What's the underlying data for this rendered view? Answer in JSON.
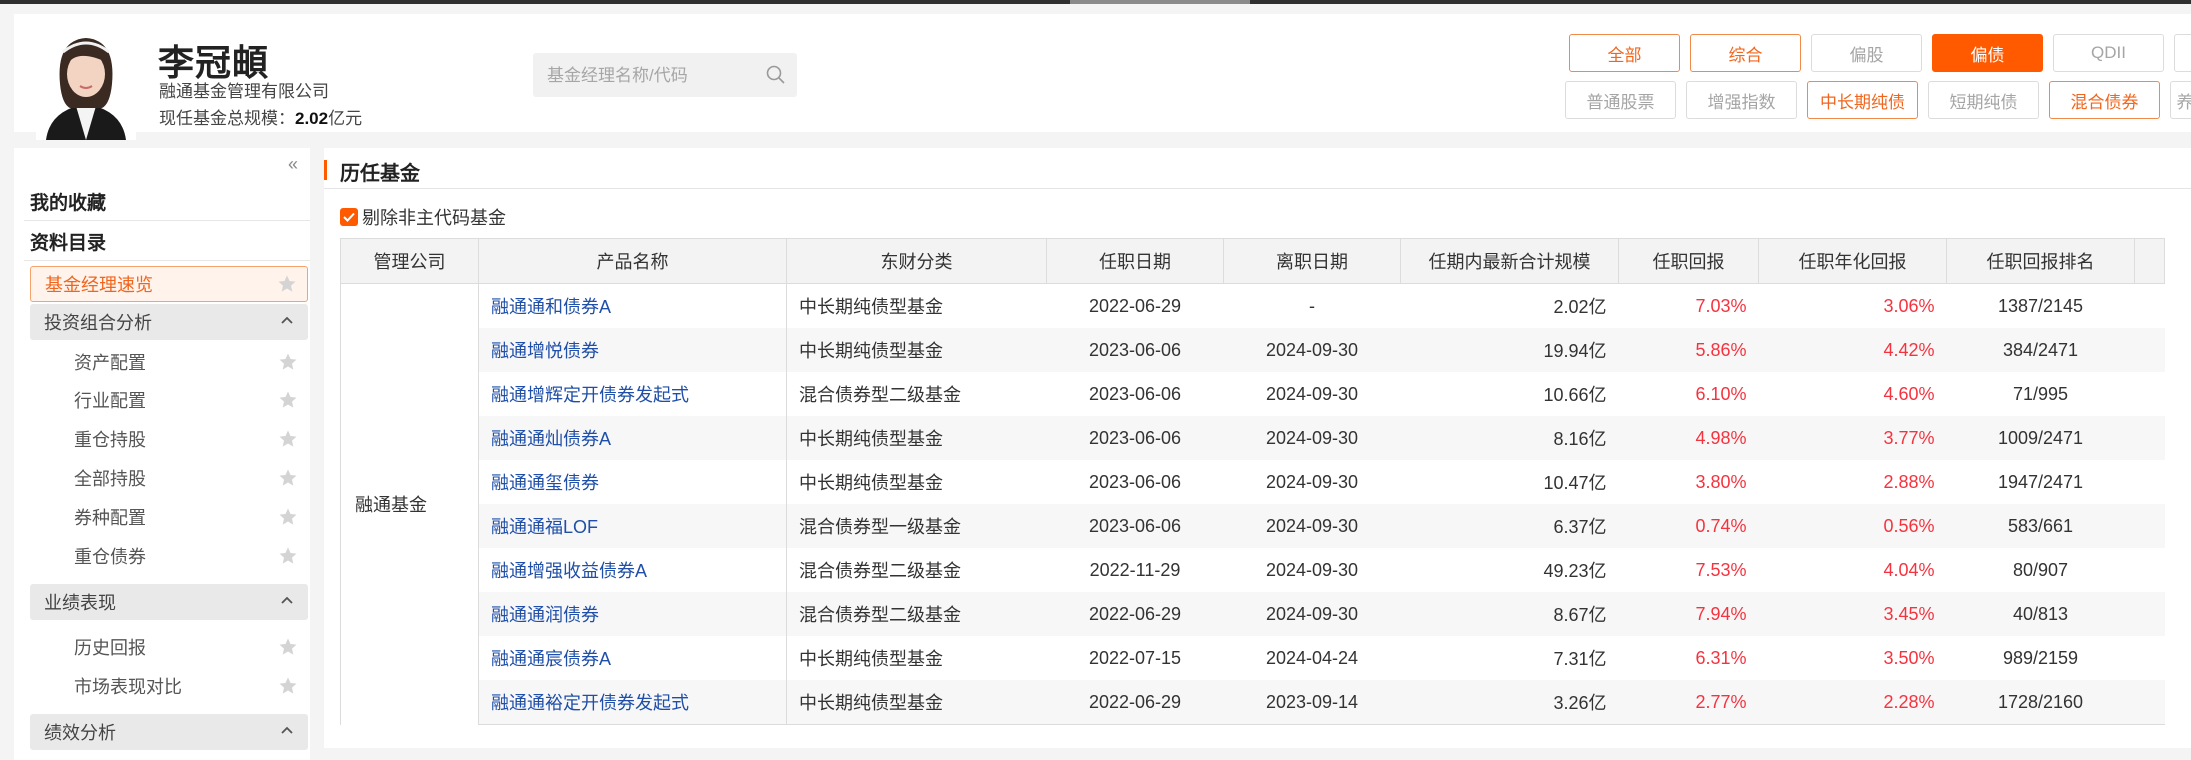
{
  "manager": {
    "name": "李冠頔",
    "company": "融通基金管理有限公司",
    "scale_label": "现任基金总规模：",
    "scale_value": "2.02",
    "scale_unit": "亿元"
  },
  "search": {
    "placeholder": "基金经理名称/代码"
  },
  "filters": {
    "row1": [
      "全部",
      "综合",
      "偏股",
      "偏债",
      "QDII",
      ""
    ],
    "row2": [
      "普通股票",
      "增强指数",
      "中长期纯债",
      "短期纯债",
      "混合债券",
      "养"
    ]
  },
  "sidebar": {
    "favorites": "我的收藏",
    "catalog": "资料目录",
    "overview": "基金经理速览",
    "groups": [
      {
        "label": "投资组合分析",
        "items": [
          "资产配置",
          "行业配置",
          "重仓持股",
          "全部持股",
          "券种配置",
          "重仓债券"
        ]
      },
      {
        "label": "业绩表现",
        "items": [
          "历史回报",
          "市场表现对比"
        ]
      },
      {
        "label": "绩效分析",
        "items": []
      }
    ]
  },
  "main": {
    "section_title": "历任基金",
    "checkbox_label": "剔除非主代码基金",
    "columns": [
      "管理公司",
      "产品名称",
      "东财分类",
      "任职日期",
      "离职日期",
      "任期内最新合计规模",
      "任职回报",
      "任职年化回报",
      "任职回报排名"
    ],
    "company": "融通基金",
    "rows": [
      {
        "name": "融通通和债券A",
        "category": "中长期纯债型基金",
        "start": "2022-06-29",
        "end": "-",
        "scale": "2.02亿",
        "ret": "7.03%",
        "annual": "3.06%",
        "rank": "1387/2145"
      },
      {
        "name": "融通增悦债券",
        "category": "中长期纯债型基金",
        "start": "2023-06-06",
        "end": "2024-09-30",
        "scale": "19.94亿",
        "ret": "5.86%",
        "annual": "4.42%",
        "rank": "384/2471"
      },
      {
        "name": "融通增辉定开债券发起式",
        "category": "混合债券型二级基金",
        "start": "2023-06-06",
        "end": "2024-09-30",
        "scale": "10.66亿",
        "ret": "6.10%",
        "annual": "4.60%",
        "rank": "71/995"
      },
      {
        "name": "融通通灿债券A",
        "category": "中长期纯债型基金",
        "start": "2023-06-06",
        "end": "2024-09-30",
        "scale": "8.16亿",
        "ret": "4.98%",
        "annual": "3.77%",
        "rank": "1009/2471"
      },
      {
        "name": "融通通玺债券",
        "category": "中长期纯债型基金",
        "start": "2023-06-06",
        "end": "2024-09-30",
        "scale": "10.47亿",
        "ret": "3.80%",
        "annual": "2.88%",
        "rank": "1947/2471"
      },
      {
        "name": "融通通福LOF",
        "category": "混合债券型一级基金",
        "start": "2023-06-06",
        "end": "2024-09-30",
        "scale": "6.37亿",
        "ret": "0.74%",
        "annual": "0.56%",
        "rank": "583/661"
      },
      {
        "name": "融通增强收益债券A",
        "category": "混合债券型二级基金",
        "start": "2022-11-29",
        "end": "2024-09-30",
        "scale": "49.23亿",
        "ret": "7.53%",
        "annual": "4.04%",
        "rank": "80/907"
      },
      {
        "name": "融通通润债券",
        "category": "混合债券型二级基金",
        "start": "2022-06-29",
        "end": "2024-09-30",
        "scale": "8.67亿",
        "ret": "7.94%",
        "annual": "3.45%",
        "rank": "40/813"
      },
      {
        "name": "融通通宸债券A",
        "category": "中长期纯债型基金",
        "start": "2022-07-15",
        "end": "2024-04-24",
        "scale": "7.31亿",
        "ret": "6.31%",
        "annual": "3.50%",
        "rank": "989/2159"
      },
      {
        "name": "融通通裕定开债券发起式",
        "category": "中长期纯债型基金",
        "start": "2022-06-29",
        "end": "2023-09-14",
        "scale": "3.26亿",
        "ret": "2.77%",
        "annual": "2.28%",
        "rank": "1728/2160"
      }
    ]
  },
  "colors": {
    "accent": "#ff5a00",
    "link": "#1f4fa8",
    "positive": "#f5333f"
  }
}
